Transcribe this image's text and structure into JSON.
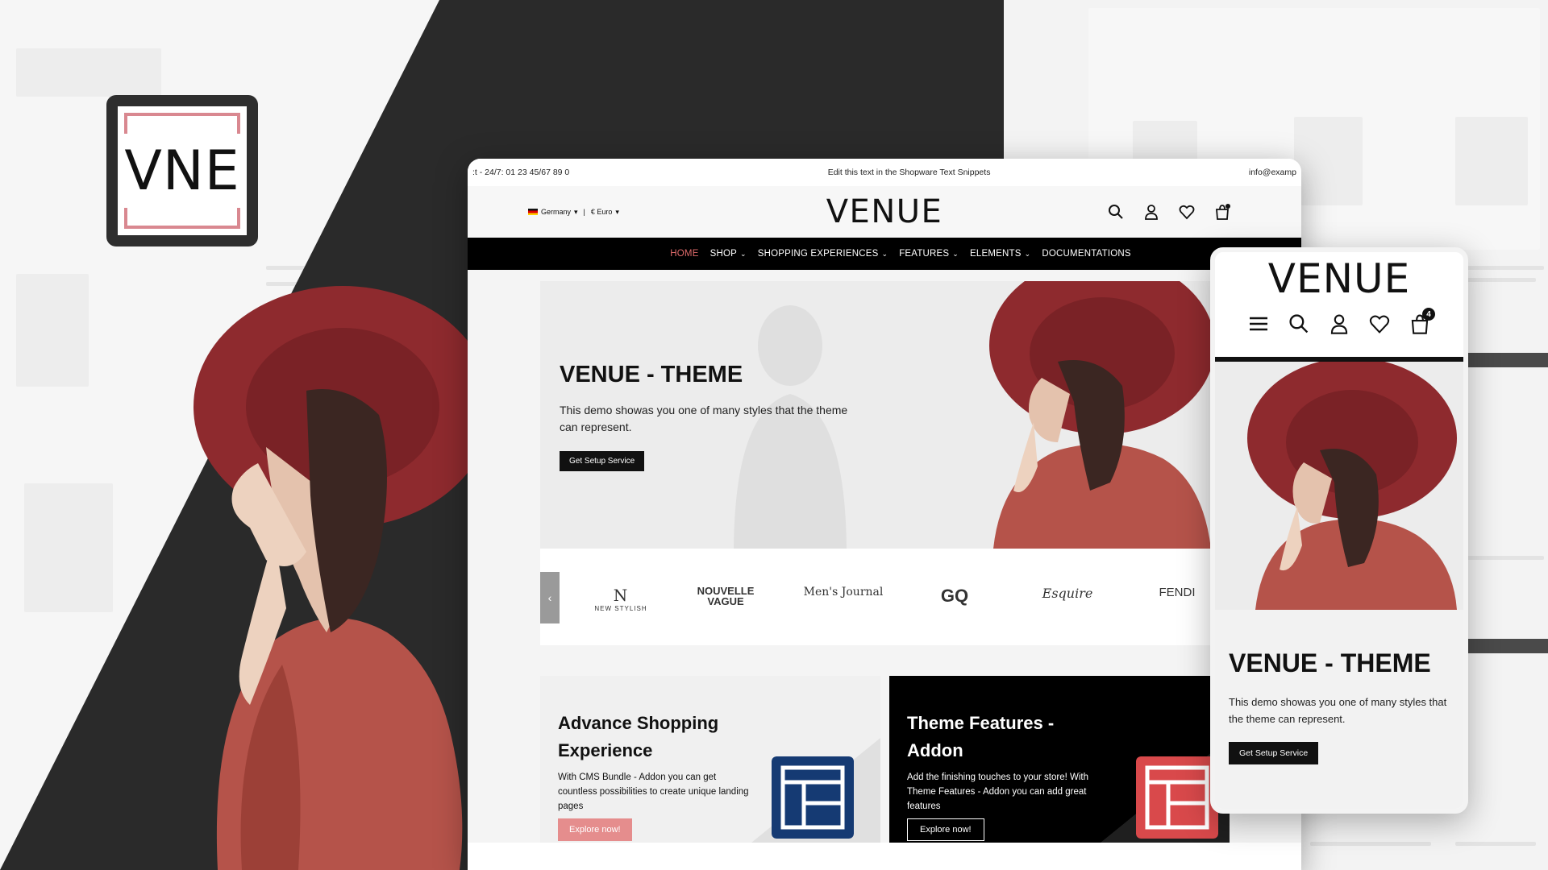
{
  "logo": {
    "text": "VNE"
  },
  "desktop": {
    "topbar": {
      "left": ":t - 24/7: 01 23 45/67 89 0",
      "center": "Edit this text in the Shopware Text Snippets",
      "right": "info@examp"
    },
    "header": {
      "language": "Germany",
      "currency": "€ Euro",
      "brand": "VENUE",
      "icons": [
        "search-icon",
        "account-icon",
        "wishlist-icon",
        "cart-icon"
      ]
    },
    "nav": [
      {
        "label": "HOME",
        "active": true,
        "dropdown": false
      },
      {
        "label": "SHOP",
        "active": false,
        "dropdown": true
      },
      {
        "label": "SHOPPING EXPERIENCES",
        "active": false,
        "dropdown": true
      },
      {
        "label": "FEATURES",
        "active": false,
        "dropdown": true
      },
      {
        "label": "ELEMENTS",
        "active": false,
        "dropdown": true
      },
      {
        "label": "DOCUMENTATIONS",
        "active": false,
        "dropdown": false
      }
    ],
    "hero": {
      "title": "VENUE - THEME",
      "text": "This demo showas you one of many styles that the theme can represent.",
      "button": "Get Setup Service"
    },
    "brands": [
      "NEW STYLISH",
      "NOUVELLE VAGUE",
      "Men's Journal",
      "GQ",
      "Esquire",
      "FENDI"
    ],
    "cards": [
      {
        "title": "Advance Shopping Experience",
        "text": "With CMS Bundle - Addon you can get countless possibilities to create unique landing pages",
        "button": "Explore now!"
      },
      {
        "title": "Theme Features - Addon",
        "text": "Add the finishing touches to your store! With Theme Features - Addon you can add great features",
        "button": "Explore now!"
      }
    ]
  },
  "mobile": {
    "brand": "VENUE",
    "cart_count": "4",
    "title": "VENUE - THEME",
    "text": "This demo showas you one of many styles that the theme can represent.",
    "button": "Get Setup Service"
  },
  "colors": {
    "accent": "#e06b6b",
    "hat": "#8e2a2e",
    "jacket": "#b5534a",
    "dark": "#2a2a2a"
  }
}
